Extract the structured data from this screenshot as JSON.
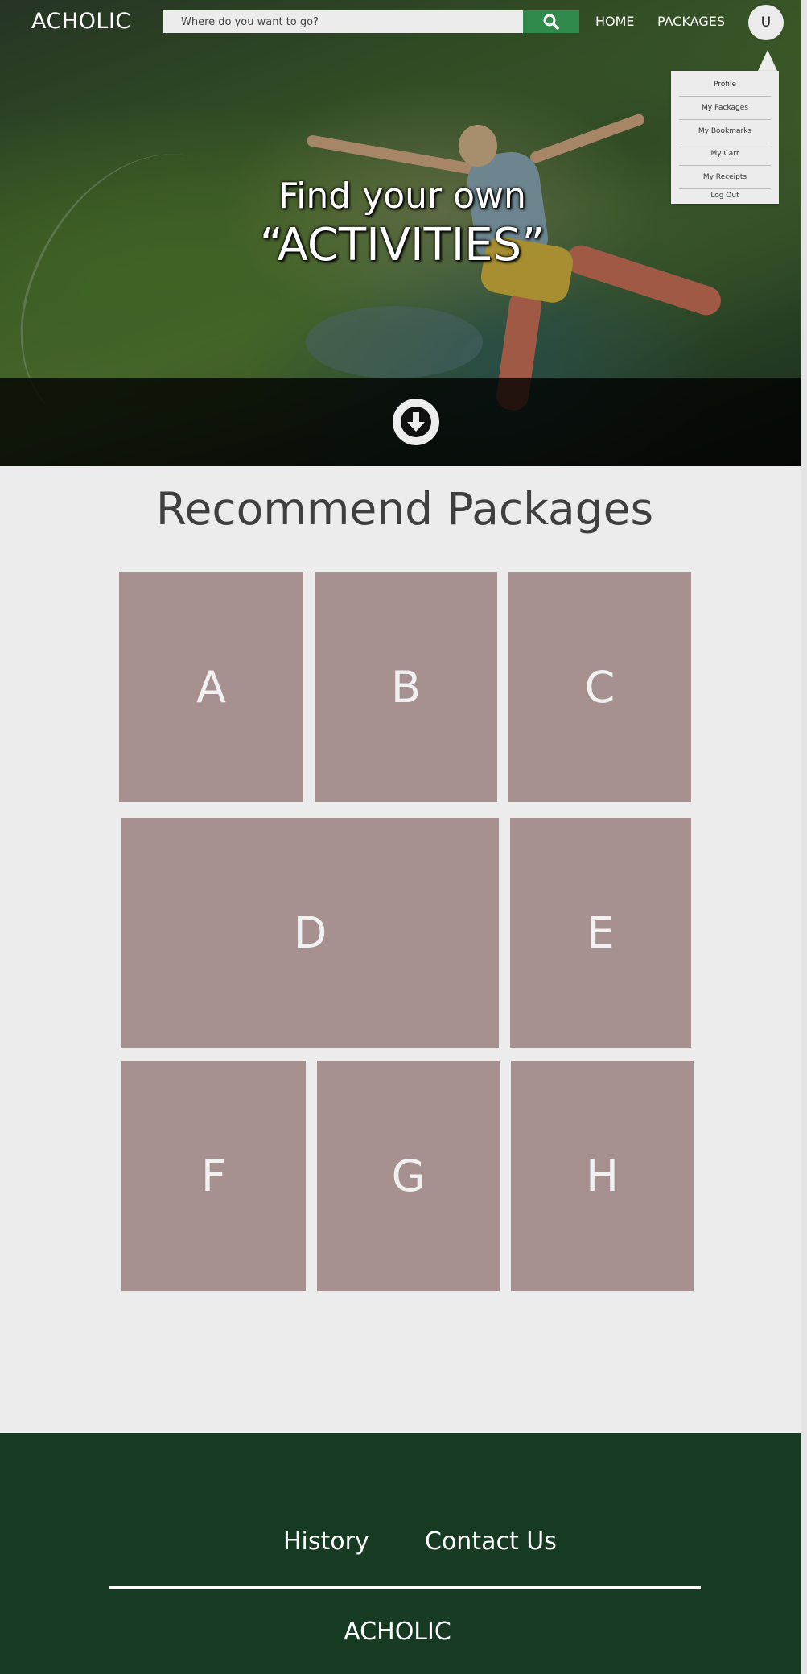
{
  "brand": {
    "logo": "ACHOLIC"
  },
  "header": {
    "search_placeholder": "Where do you want to go?",
    "search_icon": "search-icon",
    "nav": {
      "home": "HOME",
      "packages": "PACKAGES"
    },
    "avatar_initial": "U"
  },
  "user_menu": {
    "items": [
      "Profile",
      "My Packages",
      "My Bookmarks",
      "My Cart",
      "My Receipts",
      "Log Out"
    ]
  },
  "hero": {
    "line1": "Find your own",
    "line2": "“ACTIVITIES”",
    "scroll_icon": "arrow-down-circle-icon"
  },
  "recommend": {
    "title": "Recommend Packages",
    "packages": [
      "A",
      "B",
      "C",
      "D",
      "E",
      "F",
      "G",
      "H"
    ]
  },
  "footer": {
    "links": {
      "history": "History",
      "contact": "Contact Us"
    },
    "logo": "ACHOLIC"
  },
  "colors": {
    "accent_green": "#2f8a4b",
    "footer_green": "#163a22",
    "tile": "#a69090",
    "page_bg": "#ececec"
  }
}
